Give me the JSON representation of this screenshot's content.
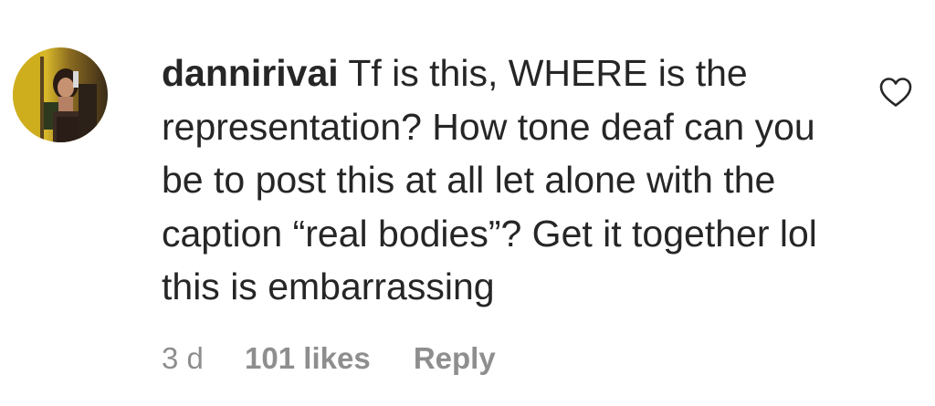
{
  "comment": {
    "username": "dannirivai",
    "text": "Tf is this, WHERE is the representation? How tone deaf can you be to post this at all let alone with the caption “real bodies”? Get it together lol this is embarrassing",
    "avatar_icon": "user-avatar-photo",
    "like_icon": "heart-outline-icon"
  },
  "meta": {
    "time": "3 d",
    "likes": "101 likes",
    "reply_label": "Reply"
  },
  "colors": {
    "text": "#262626",
    "secondary": "#8e8e8e",
    "background": "#ffffff"
  }
}
